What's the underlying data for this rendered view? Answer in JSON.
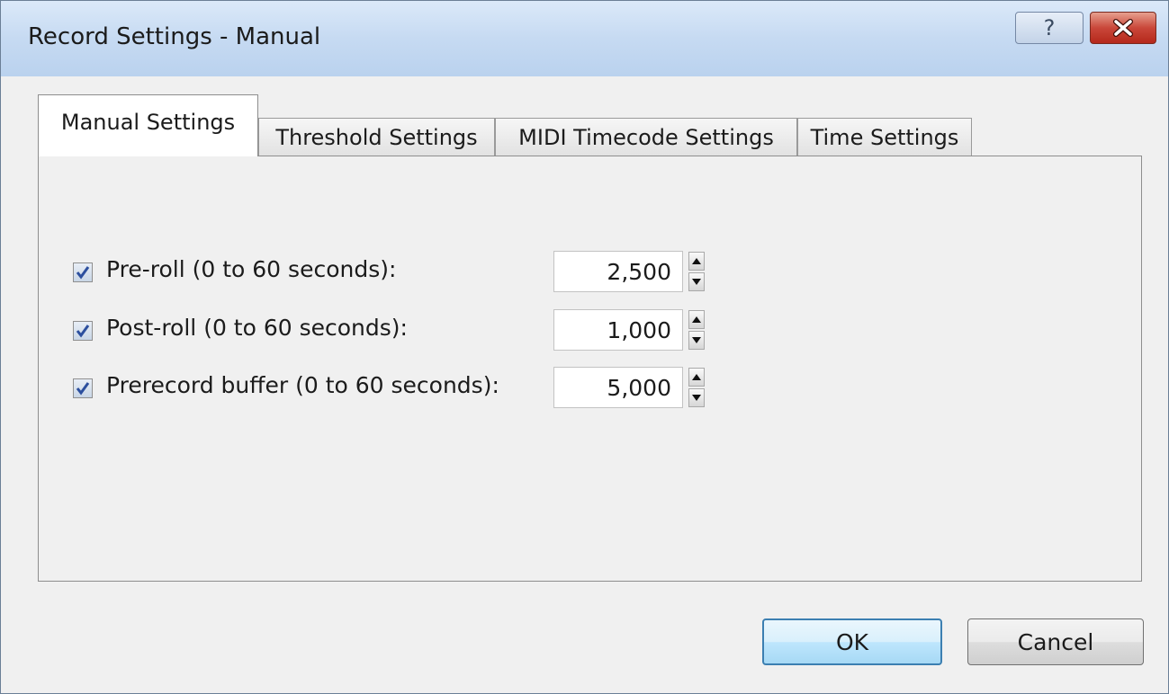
{
  "window": {
    "title": "Record Settings - Manual",
    "help_glyph": "?",
    "help_icon": "question-mark-icon",
    "close_icon": "close-x-icon"
  },
  "tabs": [
    {
      "label": "Manual Settings",
      "active": true
    },
    {
      "label": "Threshold Settings",
      "active": false
    },
    {
      "label": "MIDI Timecode Settings",
      "active": false
    },
    {
      "label": "Time Settings",
      "active": false
    }
  ],
  "settings": [
    {
      "label": "Pre-roll (0 to 60 seconds):",
      "checked": true,
      "value": "2,500"
    },
    {
      "label": "Post-roll (0 to 60 seconds):",
      "checked": true,
      "value": "1,000"
    },
    {
      "label": "Prerecord buffer (0 to 60 seconds):",
      "checked": true,
      "value": "5,000"
    }
  ],
  "buttons": {
    "ok_label": "OK",
    "cancel_label": "Cancel"
  },
  "colors": {
    "title_bar": "#c6daf2",
    "close_button": "#c9473a",
    "checkmark": "#2c4f9e",
    "default_button_border": "#3c7fb1"
  }
}
